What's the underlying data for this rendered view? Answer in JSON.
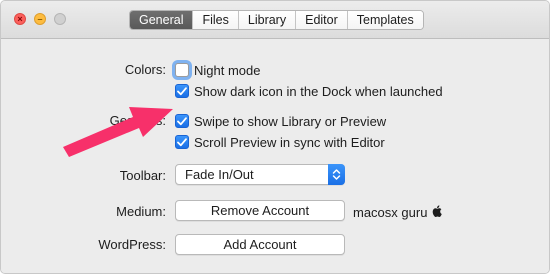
{
  "window": {
    "tabs": [
      {
        "label": "General",
        "active": true
      },
      {
        "label": "Files",
        "active": false
      },
      {
        "label": "Library",
        "active": false
      },
      {
        "label": "Editor",
        "active": false
      },
      {
        "label": "Templates",
        "active": false
      }
    ]
  },
  "colors": {
    "label": "Colors:",
    "options": [
      {
        "label": "Night mode",
        "checked": false
      },
      {
        "label": "Show dark icon in the Dock when launched",
        "checked": true
      }
    ]
  },
  "gestures": {
    "label": "Gestures:",
    "options": [
      {
        "label": "Swipe to show Library or Preview",
        "checked": true
      },
      {
        "label": "Scroll Preview in sync with Editor",
        "checked": true
      }
    ]
  },
  "toolbar": {
    "label": "Toolbar:",
    "selected": "Fade In/Out"
  },
  "medium": {
    "label": "Medium:",
    "button": "Remove Account",
    "account": "macosx guru"
  },
  "wordpress": {
    "label": "WordPress:",
    "button": "Add Account"
  },
  "accent_colors": {
    "checkbox": "#1a6fe6",
    "arrow": "#f7306a"
  }
}
